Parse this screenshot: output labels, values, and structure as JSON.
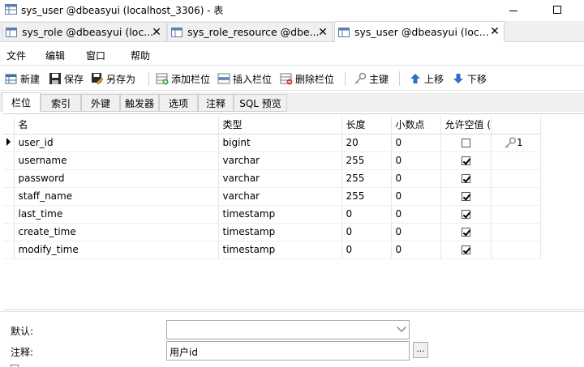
{
  "window": {
    "title": "sys_user @dbeasyui (localhost_3306) - 表",
    "minimize_icon": "minimize-icon",
    "maximize_icon": "maximize-icon"
  },
  "doc_tabs": [
    {
      "label": "sys_role @dbeasyui (loc...",
      "close": "✕",
      "active": false
    },
    {
      "label": "sys_role_resource @dbe...",
      "close": "✕",
      "active": false
    },
    {
      "label": "sys_user @dbeasyui (loc...",
      "close": "✕",
      "active": true
    }
  ],
  "menu": [
    "文件",
    "编辑",
    "窗口",
    "帮助"
  ],
  "toolbar": {
    "new": "新建",
    "save": "保存",
    "save_as": "另存为",
    "add_field": "添加栏位",
    "insert_field": "插入栏位",
    "delete_field": "删除栏位",
    "primary_key": "主键",
    "move_up": "上移",
    "move_down": "下移"
  },
  "sub_tabs": [
    "栏位",
    "索引",
    "外键",
    "触发器",
    "选项",
    "注释",
    "SQL 预览"
  ],
  "grid": {
    "headers": [
      "名",
      "类型",
      "长度",
      "小数点",
      "允许空值 (",
      ""
    ],
    "rows": [
      {
        "name": "user_id",
        "type": "bigint",
        "length": "20",
        "decimals": "0",
        "nullable": false,
        "key": "1",
        "current": true
      },
      {
        "name": "username",
        "type": "varchar",
        "length": "255",
        "decimals": "0",
        "nullable": true,
        "key": "",
        "current": false
      },
      {
        "name": "password",
        "type": "varchar",
        "length": "255",
        "decimals": "0",
        "nullable": true,
        "key": "",
        "current": false
      },
      {
        "name": "staff_name",
        "type": "varchar",
        "length": "255",
        "decimals": "0",
        "nullable": true,
        "key": "",
        "current": false
      },
      {
        "name": "last_time",
        "type": "timestamp",
        "length": "0",
        "decimals": "0",
        "nullable": true,
        "key": "",
        "current": false
      },
      {
        "name": "create_time",
        "type": "timestamp",
        "length": "0",
        "decimals": "0",
        "nullable": true,
        "key": "",
        "current": false
      },
      {
        "name": "modify_time",
        "type": "timestamp",
        "length": "0",
        "decimals": "0",
        "nullable": true,
        "key": "",
        "current": false
      }
    ]
  },
  "properties": {
    "default_label": "默认:",
    "default_value": "",
    "comment_label": "注释:",
    "comment_value": "用户id",
    "browse_button": "..."
  }
}
